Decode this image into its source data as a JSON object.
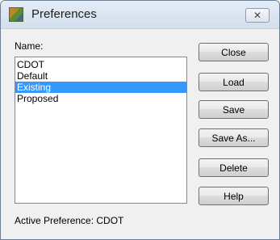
{
  "window": {
    "title": "Preferences",
    "close_glyph": "✕",
    "app_icon": "preferences-app-icon"
  },
  "name_label": "Name:",
  "list": {
    "items": [
      "CDOT",
      "Default",
      "Existing",
      "Proposed"
    ],
    "selected": "Existing"
  },
  "buttons": {
    "close": "Close",
    "load": "Load",
    "save": "Save",
    "save_as": "Save As...",
    "delete": "Delete",
    "help": "Help"
  },
  "status": {
    "active_preference": "Active Preference: CDOT"
  },
  "colors": {
    "selection": "#3399ff",
    "dialog_background": "#f0f0f0"
  }
}
